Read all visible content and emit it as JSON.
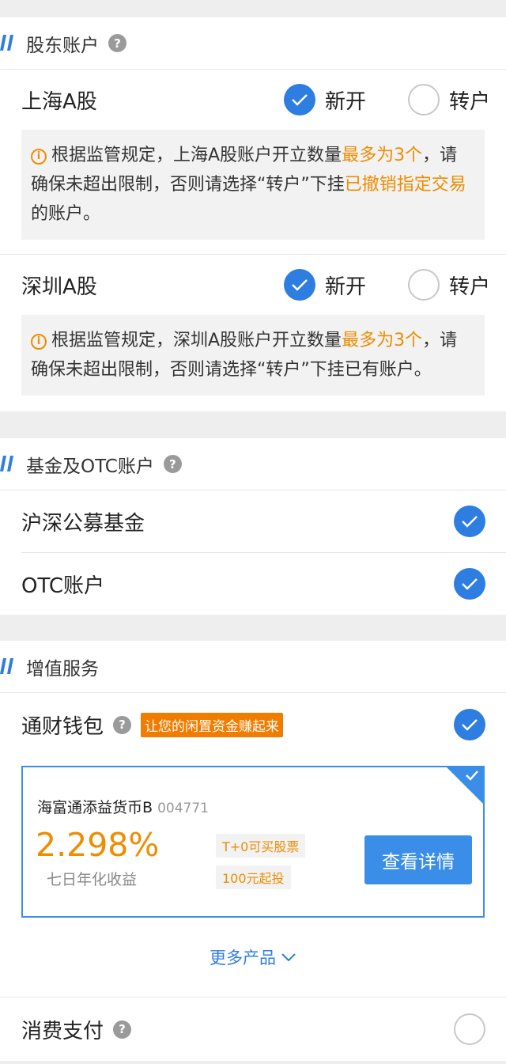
{
  "shareholder": {
    "title": "股东账户",
    "accounts": [
      {
        "name": "上海A股",
        "open_label": "新开",
        "transfer_label": "转户",
        "notice": [
          {
            "text": "根据监管规定，上海A股账户开立数量",
            "hl": false
          },
          {
            "text": "最多为3个",
            "hl": true
          },
          {
            "text": "，请确保未超出限制，否则请选择“转户”下挂",
            "hl": false
          },
          {
            "text": "已撤销指定交易",
            "hl": true
          },
          {
            "text": "的账户。",
            "hl": false
          }
        ]
      },
      {
        "name": "深圳A股",
        "open_label": "新开",
        "transfer_label": "转户",
        "notice": [
          {
            "text": "根据监管规定，深圳A股账户开立数量",
            "hl": false
          },
          {
            "text": "最多为3个",
            "hl": true
          },
          {
            "text": "，请确保未超出限制，否则请选择“转户”下挂已有账户。",
            "hl": false
          }
        ]
      }
    ]
  },
  "fund": {
    "title": "基金及OTC账户",
    "items": [
      "沪深公募基金",
      "OTC账户"
    ]
  },
  "value_added": {
    "title": "增值服务",
    "wallet": {
      "name": "通财钱包",
      "badge": "让您的闲置资金赚起来"
    },
    "product": {
      "name": "海富通添益货币B",
      "code": "004771",
      "rate": "2.298%",
      "rate_label": "七日年化收益",
      "tag1": "T+0可买股票",
      "tag2": "100元起投",
      "button": "查看详情"
    },
    "more_label": "更多产品",
    "payment": {
      "name": "消费支付"
    }
  },
  "colors": {
    "accent": "#2e7de1",
    "highlight": "#f08c00",
    "badge": "#f07c00"
  }
}
